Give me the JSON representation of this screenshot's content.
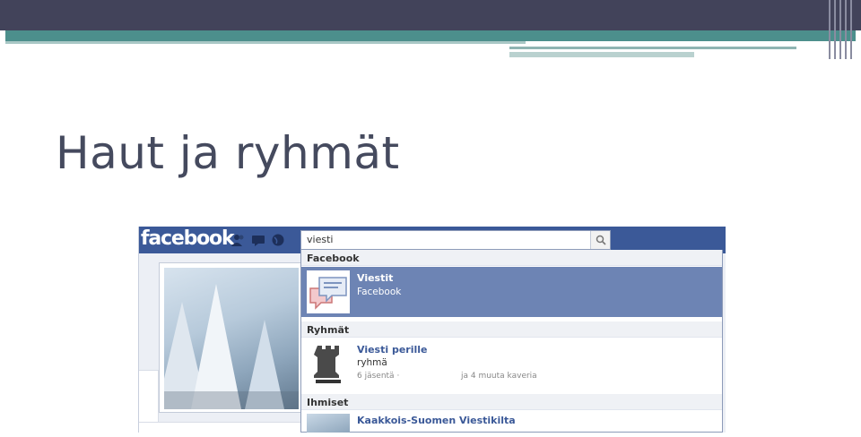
{
  "slide": {
    "title": "Haut ja ryhmät"
  },
  "facebook": {
    "logo": "facebook",
    "search": {
      "value": "viesti"
    },
    "sections": [
      {
        "heading": "Facebook",
        "results": [
          {
            "title": "Viestit",
            "subtitle": "Facebook",
            "selected": true,
            "icon": "messages-icon"
          }
        ]
      },
      {
        "heading": "Ryhmät",
        "results": [
          {
            "title": "Viesti perille",
            "subtitle": "ryhmä",
            "meta": "6 jäsentä ·",
            "meta2": "ja 4 muuta kaveria",
            "icon": "rook-icon"
          }
        ]
      },
      {
        "heading": "Ihmiset",
        "results": [
          {
            "title": "Kaakkois-Suomen Viestikilta",
            "icon": "profile-thumb"
          }
        ]
      }
    ]
  },
  "colors": {
    "fb_blue": "#3b5998",
    "selected": "#6d84b4",
    "slide_dark": "#42435a",
    "slide_teal": "#4c8f8c"
  }
}
